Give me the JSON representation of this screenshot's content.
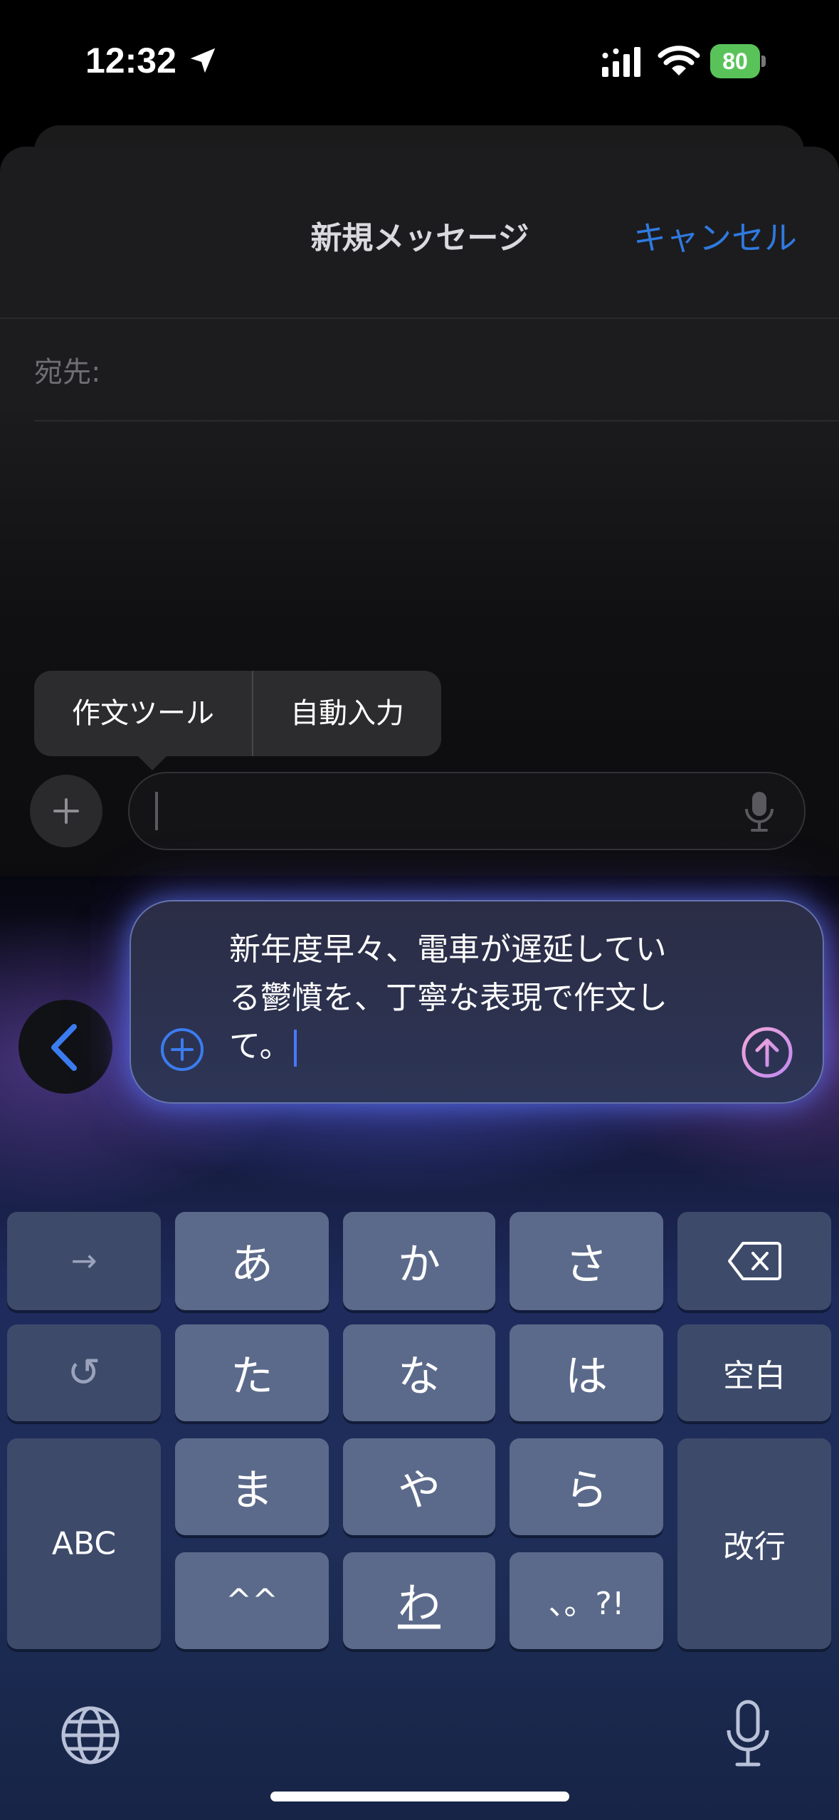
{
  "status_bar": {
    "time": "12:32",
    "battery": "80"
  },
  "header": {
    "title": "新規メッセージ",
    "cancel_label": "キャンセル"
  },
  "recipient": {
    "label": "宛先:"
  },
  "popover": {
    "items": [
      "作文ツール",
      "自動入力"
    ]
  },
  "writing_tools": {
    "prompt_text": "新年度早々、電車が遅延している鬱憤を、丁寧な表現で作文して。",
    "line1": "新年度早々、電車が遅延してい",
    "line2": "る鬱憤を、丁寧な表現で作文し",
    "line3": "て。"
  },
  "keyboard": {
    "row1": [
      "→",
      "あ",
      "か",
      "さ",
      "delete"
    ],
    "row2": [
      "↺",
      "た",
      "な",
      "は",
      "空白"
    ],
    "row3": [
      "ま",
      "や",
      "ら"
    ],
    "row4": [
      "^^",
      "わ",
      "、。?!"
    ],
    "abc_label": "ABC",
    "return_label": "改行",
    "arrow_label": "→",
    "undo_label": "↺",
    "space_label": "空白"
  },
  "colors": {
    "accent": "#2f7ae0",
    "battery": "#59c35a",
    "key": "#5b6a8a",
    "key_dark": "#3d4a6a"
  }
}
